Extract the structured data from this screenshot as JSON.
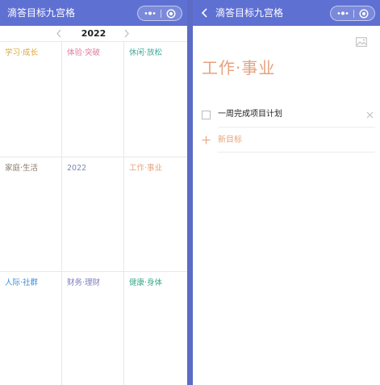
{
  "left": {
    "nav_title": "滴答目标九宫格",
    "year": "2022",
    "cells": [
      {
        "label": "学习·成长",
        "color": "#d9a93a"
      },
      {
        "label": "体验·突破",
        "color": "#e07a9a"
      },
      {
        "label": "休闲·放松",
        "color": "#3aa89a"
      },
      {
        "label": "家庭·生活",
        "color": "#8a7a6e"
      },
      {
        "label": "2022",
        "color": "#7a88b0"
      },
      {
        "label": "工作·事业",
        "color": "#e5a37e"
      },
      {
        "label": "人际·社群",
        "color": "#3d8fd6"
      },
      {
        "label": "财务·理财",
        "color": "#7a7cc0"
      },
      {
        "label": "健康·身体",
        "color": "#3aaa8a"
      }
    ]
  },
  "right": {
    "nav_title": "滴答目标九宫格",
    "page_title": "工作·事业",
    "tasks": [
      {
        "label": "一周完成项目计划",
        "checked": false
      }
    ],
    "new_goal_label": "新目标"
  },
  "colors": {
    "navbar": "#5f70d3",
    "accent": "#e5a37e"
  },
  "icons": [
    "back-icon",
    "more-icon",
    "close-icon",
    "chevron-left-icon",
    "chevron-right-icon",
    "image-icon",
    "delete-icon",
    "plus-icon"
  ]
}
